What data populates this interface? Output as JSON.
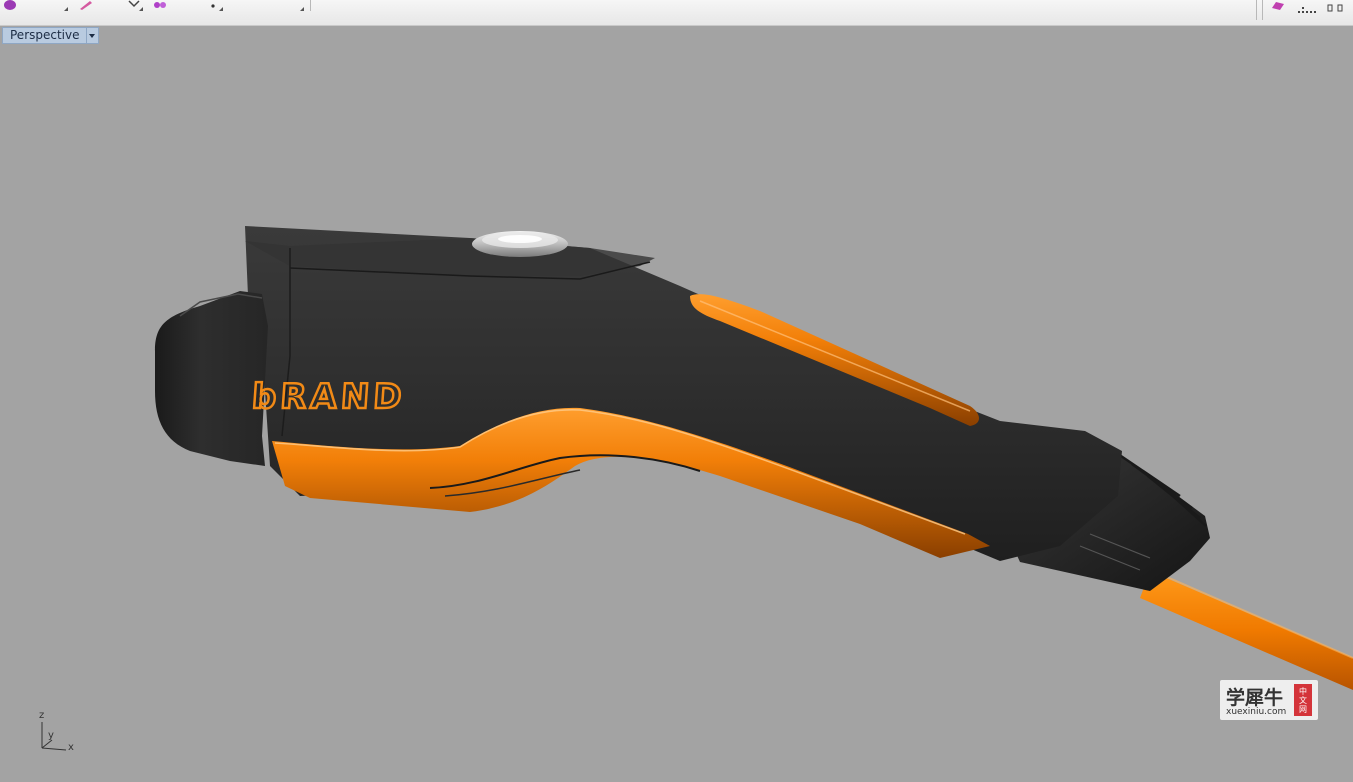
{
  "viewport": {
    "label": "Perspective",
    "background": "#a3a3a3"
  },
  "model": {
    "logo_text": "bRAND",
    "body_color": "#2d2d2d",
    "accent_color": "#f08000"
  },
  "axes": {
    "z": "z",
    "y": "y",
    "x": "x"
  },
  "watermark": {
    "name": "学犀牛",
    "url": "xuexiniu.com",
    "badge": [
      "中",
      "文",
      "网"
    ],
    "badge_color": "#d4343a"
  },
  "toolbar": {
    "icons": [
      "shape-tool-icon",
      "pen-tool-icon",
      "transform-tool-icon",
      "flower-tool-icon",
      "point-tool-icon",
      "layer-tool-icon",
      "panel-tool-icon",
      "grid-tool-icon"
    ]
  }
}
